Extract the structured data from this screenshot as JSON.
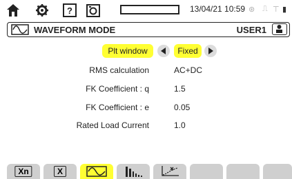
{
  "status": {
    "datetime": "13/04/21 10:59",
    "tray_icons": [
      "settings-icon",
      "usb-icon",
      "network-icon",
      "battery-icon"
    ]
  },
  "header": {
    "title": "WAVEFORM MODE",
    "user": "USER1"
  },
  "settings": {
    "plt_window_label": "Plt window",
    "plt_window_value": "Fixed",
    "rows": [
      {
        "label": "RMS calculation",
        "value": "AC+DC"
      },
      {
        "label": "FK Coefficient : q",
        "value": "1.5"
      },
      {
        "label": "FK Coefficient : e",
        "value": "0.05"
      },
      {
        "label": "Rated Load Current",
        "value": "1.0"
      }
    ]
  },
  "softkeys": [
    {
      "label": "Xn",
      "icon": "xn-icon",
      "active": false
    },
    {
      "label": "X",
      "icon": "x-icon",
      "active": false
    },
    {
      "label": "",
      "icon": "waveform-icon",
      "active": true
    },
    {
      "label": "",
      "icon": "harmonics-icon",
      "active": false
    },
    {
      "label": "",
      "icon": "curve-icon",
      "active": false
    },
    {
      "label": "",
      "icon": "",
      "active": false
    },
    {
      "label": "",
      "icon": "",
      "active": false
    },
    {
      "label": "",
      "icon": "",
      "active": false
    }
  ],
  "colors": {
    "highlight": "#ffff33",
    "softkey": "#cfcfcf"
  }
}
